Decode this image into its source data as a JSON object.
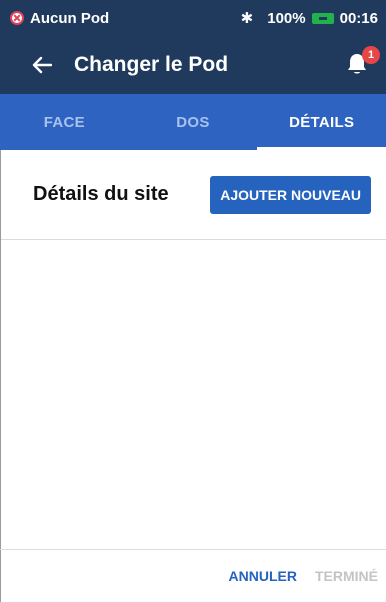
{
  "status_bar": {
    "pod_status": "Aucun Pod",
    "bluetooth_icon": "bluetooth-icon",
    "battery_percent": "100%",
    "battery_color": "#22b24c",
    "time": "00:16"
  },
  "header": {
    "back_icon": "arrow-left-icon",
    "title": "Changer le Pod",
    "notification_icon": "bell-icon",
    "notification_count": "1"
  },
  "tabs": [
    {
      "label": "FACE",
      "active": false
    },
    {
      "label": "DOS",
      "active": false
    },
    {
      "label": "DÉTAILS",
      "active": true
    }
  ],
  "main": {
    "section_title": "Détails du site",
    "add_button_label": "AJOUTER NOUVEAU"
  },
  "footer": {
    "cancel_label": "ANNULER",
    "done_label": "TERMINÉ"
  },
  "colors": {
    "header_bg": "#1f3a5c",
    "tab_bg": "#2f63c2",
    "accent": "#2563be",
    "badge": "#e64646"
  }
}
